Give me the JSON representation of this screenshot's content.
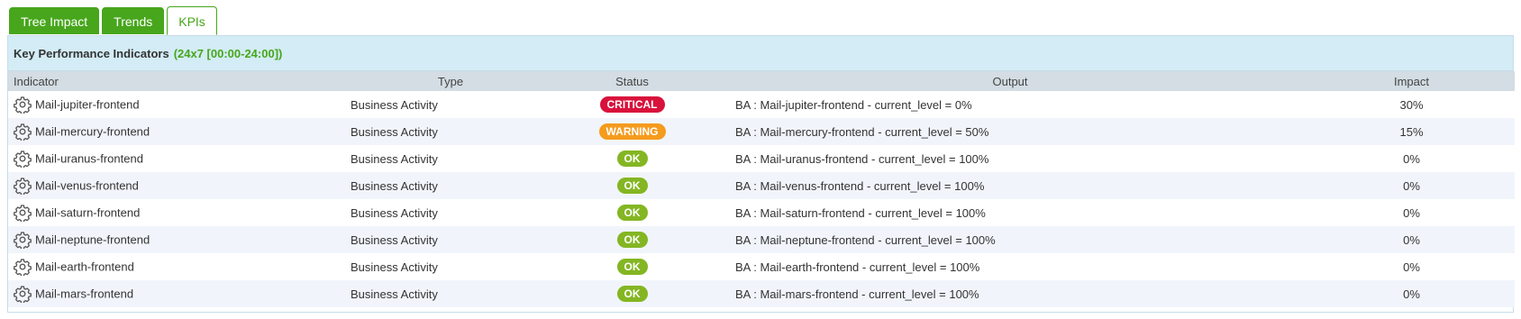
{
  "tabs": [
    {
      "label": "Tree Impact"
    },
    {
      "label": "Trends"
    },
    {
      "label": "KPIs"
    }
  ],
  "panel": {
    "title": "Key Performance Indicators",
    "schedule": "(24x7 [00:00-24:00])"
  },
  "columns": {
    "indicator": "Indicator",
    "type": "Type",
    "status": "Status",
    "output": "Output",
    "impact": "Impact"
  },
  "status_colors": {
    "CRITICAL": "#d9123c",
    "WARNING": "#f59b1e",
    "OK": "#84b623"
  },
  "rows": [
    {
      "icon": "gear-icon",
      "indicator": "Mail-jupiter-frontend",
      "type": "Business Activity",
      "status": "CRITICAL",
      "output": "BA : Mail-jupiter-frontend - current_level = 0%",
      "impact": "30%"
    },
    {
      "icon": "gear-icon",
      "indicator": "Mail-mercury-frontend",
      "type": "Business Activity",
      "status": "WARNING",
      "output": "BA : Mail-mercury-frontend - current_level = 50%",
      "impact": "15%"
    },
    {
      "icon": "gear-icon",
      "indicator": "Mail-uranus-frontend",
      "type": "Business Activity",
      "status": "OK",
      "output": "BA : Mail-uranus-frontend - current_level = 100%",
      "impact": "0%"
    },
    {
      "icon": "gear-icon",
      "indicator": "Mail-venus-frontend",
      "type": "Business Activity",
      "status": "OK",
      "output": "BA : Mail-venus-frontend - current_level = 100%",
      "impact": "0%"
    },
    {
      "icon": "gear-icon",
      "indicator": "Mail-saturn-frontend",
      "type": "Business Activity",
      "status": "OK",
      "output": "BA : Mail-saturn-frontend - current_level = 100%",
      "impact": "0%"
    },
    {
      "icon": "gear-icon",
      "indicator": "Mail-neptune-frontend",
      "type": "Business Activity",
      "status": "OK",
      "output": "BA : Mail-neptune-frontend - current_level = 100%",
      "impact": "0%"
    },
    {
      "icon": "gear-icon",
      "indicator": "Mail-earth-frontend",
      "type": "Business Activity",
      "status": "OK",
      "output": "BA : Mail-earth-frontend - current_level = 100%",
      "impact": "0%"
    },
    {
      "icon": "gear-icon",
      "indicator": "Mail-mars-frontend",
      "type": "Business Activity",
      "status": "OK",
      "output": "BA : Mail-mars-frontend - current_level = 100%",
      "impact": "0%"
    }
  ]
}
